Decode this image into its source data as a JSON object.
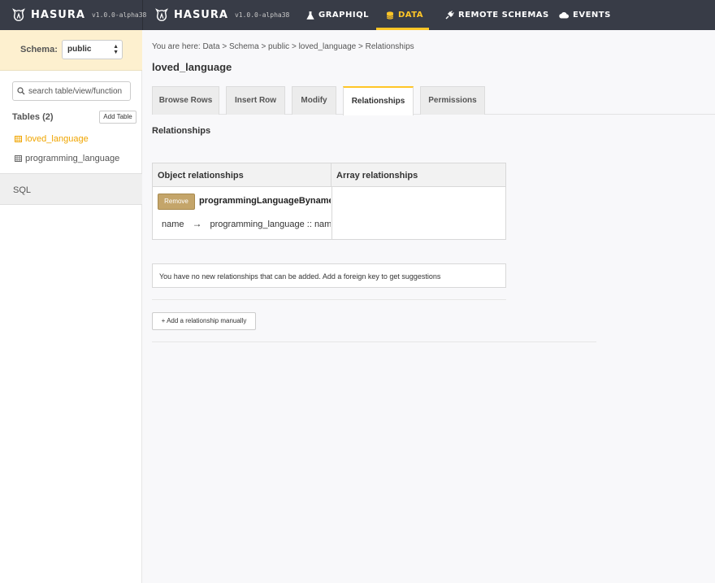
{
  "topbar": {
    "brand_name": "HASURA",
    "version": "v1.0.0-alpha38",
    "nav": [
      {
        "label": "GRAPHIQL",
        "icon": "flask-icon"
      },
      {
        "label": "DATA",
        "icon": "database-icon",
        "active": true
      },
      {
        "label": "REMOTE SCHEMAS",
        "icon": "plug-icon"
      },
      {
        "label": "EVENTS",
        "icon": "cloud-icon"
      }
    ],
    "accent_color": "#ffc627",
    "background_color": "#383c47"
  },
  "sidebar": {
    "schema_label": "Schema:",
    "schema_value": "public",
    "search_placeholder": "search table/view/function",
    "tables_title": "Tables (2)",
    "add_table_label": "Add Table",
    "tables": [
      {
        "name": "loved_language",
        "active": true
      },
      {
        "name": "programming_language",
        "active": false
      }
    ],
    "sql_label": "SQL"
  },
  "main": {
    "breadcrumb": "You are here: Data > Schema > public > loved_language > Relationships",
    "title": "loved_language",
    "tabs": [
      {
        "label": "Browse Rows"
      },
      {
        "label": "Insert Row"
      },
      {
        "label": "Modify"
      },
      {
        "label": "Relationships",
        "active": true
      },
      {
        "label": "Permissions"
      }
    ],
    "section_title": "Relationships",
    "relationships_table": {
      "object_header": "Object relationships",
      "array_header": "Array relationships",
      "object_rows": [
        {
          "remove_label": "Remove",
          "name": "programmingLanguageByname",
          "from_column": "name",
          "arrow": "→",
          "to": "programming_language :: name"
        }
      ]
    },
    "suggestion_text": "You have no new relationships that can be added. Add a foreign key to get suggestions",
    "add_manual_label": "+ Add a relationship manually"
  }
}
